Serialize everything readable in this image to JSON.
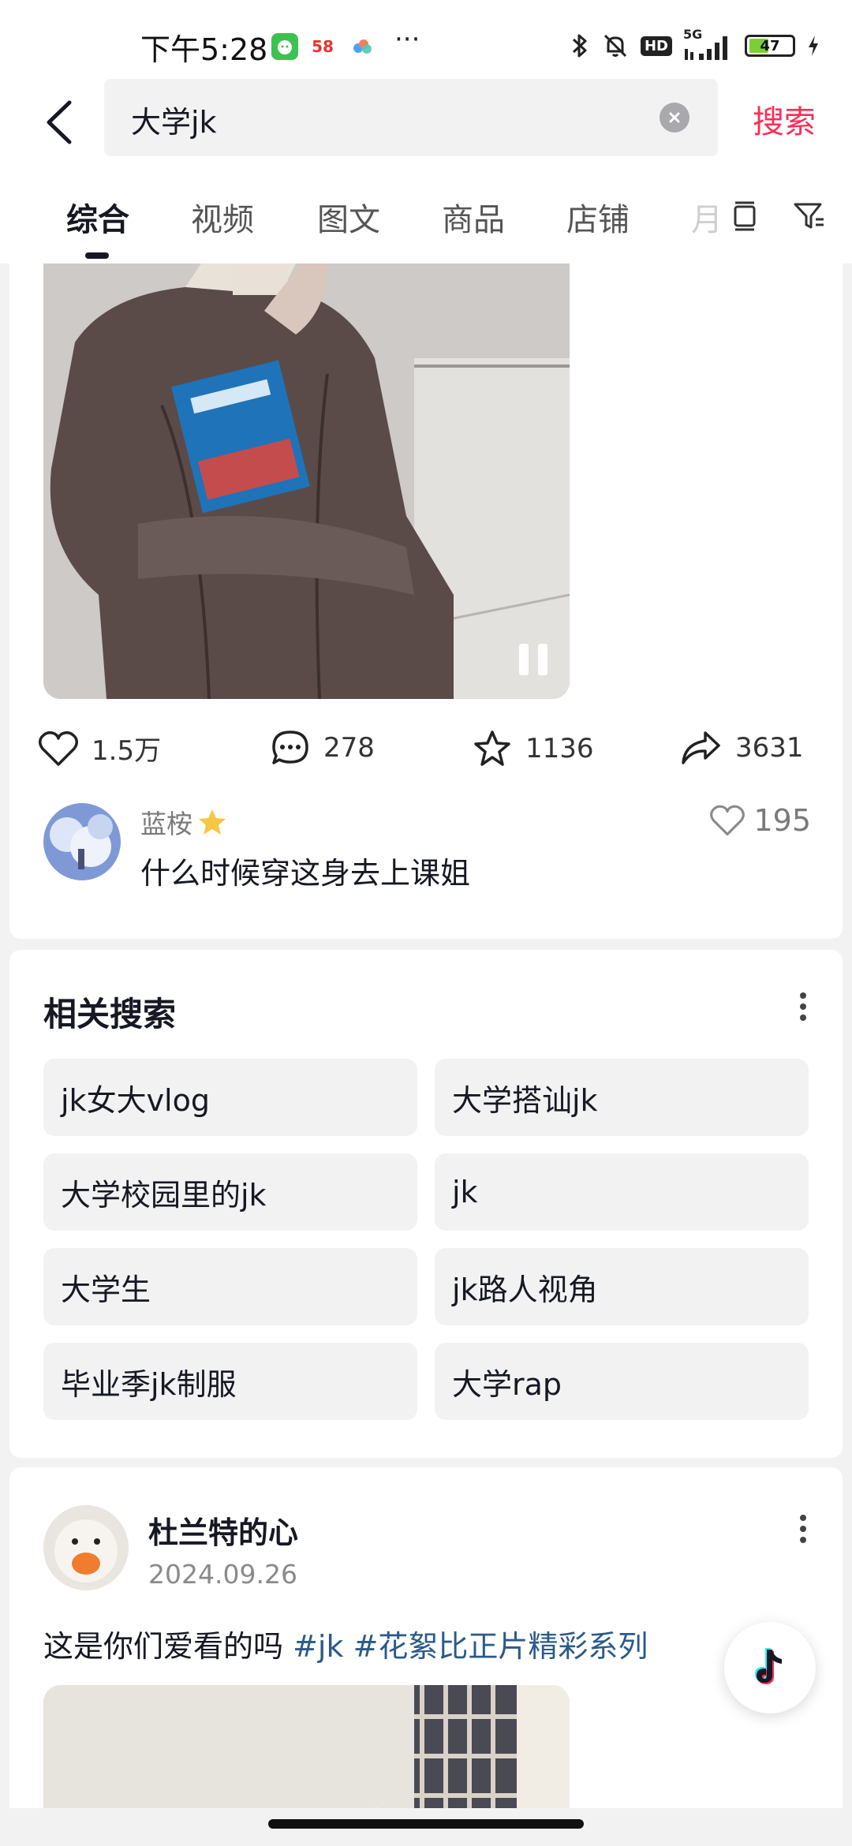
{
  "status_bar": {
    "time": "下午5:28",
    "app_icon_58": "58",
    "more": "···",
    "network": "5G",
    "hd": "HD",
    "battery": "47",
    "battery_level_pct": 47
  },
  "search": {
    "query": "大学jk",
    "submit_label": "搜索"
  },
  "tabs": {
    "items": [
      "综合",
      "视频",
      "图文",
      "商品",
      "店铺"
    ],
    "active_index": 0,
    "truncated": "月"
  },
  "video_post": {
    "actions": {
      "likes": "1.5万",
      "comments": "278",
      "favorites": "1136",
      "shares": "3631"
    },
    "top_comment": {
      "user": "蓝桉",
      "text": "什么时候穿这身去上课姐",
      "likes": "195"
    }
  },
  "related": {
    "title": "相关搜索",
    "items": [
      "jk女大vlog",
      "大学搭讪jk",
      "大学校园里的jk",
      "jk",
      "大学生",
      "jk路人视角",
      "毕业季jk制服",
      "大学rap"
    ]
  },
  "post": {
    "user": "杜兰特的心",
    "date": "2024.09.26",
    "text": "这是你们爱看的吗 ",
    "hashtags": [
      "#jk",
      "#花絮比正片精彩系列"
    ]
  },
  "colors": {
    "accent": "#fe2c55",
    "hashtag": "#2b5a8a",
    "chip_bg": "#f2f2f3"
  },
  "icons": {
    "back": "back-arrow-icon",
    "clear": "clear-icon",
    "like": "heart-icon",
    "comment": "comment-icon",
    "favorite": "star-icon",
    "share": "share-icon",
    "more": "more-vertical-icon",
    "fab": "tiktok-icon"
  }
}
